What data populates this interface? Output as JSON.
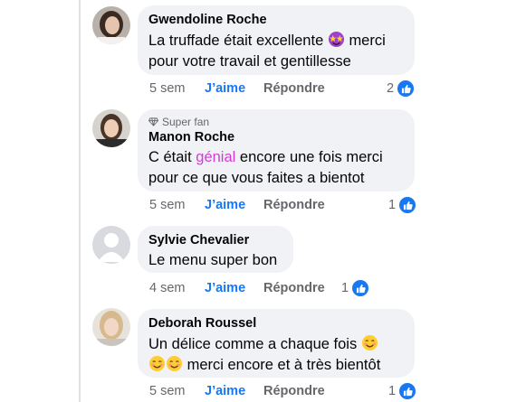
{
  "colors": {
    "bubble": "#f0f2f5",
    "like_blue": "#1877f2",
    "meta_gray": "#65676b",
    "highlight": "#d63ad6"
  },
  "comments": [
    {
      "author": "Gwendoline Roche",
      "text_line1": "La truffade était excellente",
      "emoji1": "star-struck-emoji",
      "text_line1_end": "merci",
      "text_line2": "pour votre travail et gentillesse",
      "time": "5 sem",
      "like_label": "J’aime",
      "reply_label": "Répondre",
      "reaction_count": "2"
    },
    {
      "superfan_label": "Super fan",
      "author": "Manon Roche",
      "text_pre": "C était ",
      "text_highlight": "génial",
      "text_post": " encore une fois merci",
      "text_line2": "pour ce que vous faites a bientot",
      "time": "5 sem",
      "like_label": "J’aime",
      "reply_label": "Répondre",
      "reaction_count": "1"
    },
    {
      "author": "Sylvie Chevalier",
      "text_line1": "Le menu super bon",
      "time": "4 sem",
      "like_label": "J’aime",
      "reply_label": "Répondre",
      "reaction_count": "1"
    },
    {
      "author": "Deborah Roussel",
      "text_line1": "Un délice comme a chaque fois",
      "emoji1": "smiling-emoji",
      "text_line2": "merci encore et à très bientôt",
      "emoji2": "smiling-emoji",
      "time": "5 sem",
      "like_label": "J’aime",
      "reply_label": "Répondre",
      "reaction_count": "1"
    }
  ]
}
